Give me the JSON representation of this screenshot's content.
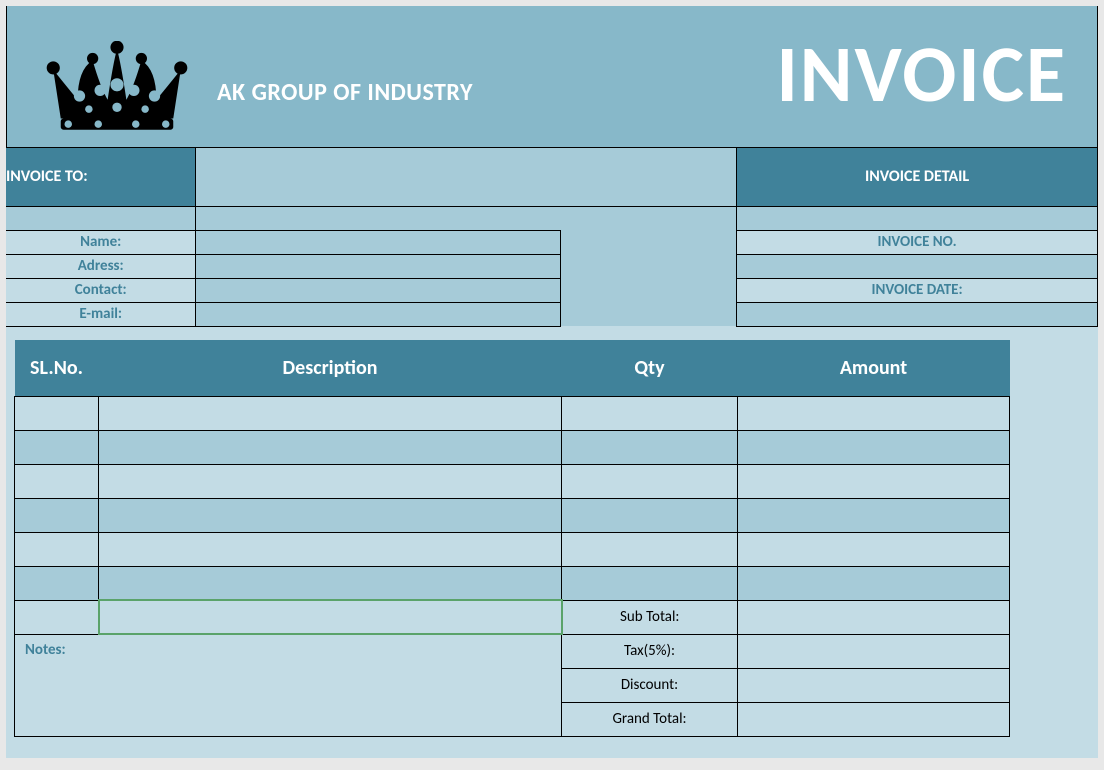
{
  "header": {
    "company": "AK GROUP OF INDUSTRY",
    "title": "INVOICE"
  },
  "invoice_to": {
    "heading": "INVOICE TO:",
    "fields": {
      "name_label": "Name:",
      "address_label": "Adress:",
      "contact_label": "Contact:",
      "email_label": "E-mail:",
      "name": "",
      "address": "",
      "contact": "",
      "email": ""
    }
  },
  "invoice_detail": {
    "heading": "INVOICE DETAIL",
    "no_label": "INVOICE NO.",
    "no_value": "",
    "date_label": "INVOICE DATE:",
    "date_value": ""
  },
  "columns": {
    "sl": "SL.No.",
    "desc": "Description",
    "qty": "Qty",
    "amount": "Amount"
  },
  "rows": [
    {
      "sl": "",
      "desc": "",
      "qty": "",
      "amount": ""
    },
    {
      "sl": "",
      "desc": "",
      "qty": "",
      "amount": ""
    },
    {
      "sl": "",
      "desc": "",
      "qty": "",
      "amount": ""
    },
    {
      "sl": "",
      "desc": "",
      "qty": "",
      "amount": ""
    },
    {
      "sl": "",
      "desc": "",
      "qty": "",
      "amount": ""
    },
    {
      "sl": "",
      "desc": "",
      "qty": "",
      "amount": ""
    }
  ],
  "totals": {
    "subtotal_label": "Sub Total:",
    "tax_label": "Tax(5%):",
    "discount_label": "Discount:",
    "grand_label": "Grand Total:",
    "subtotal": "",
    "tax": "",
    "discount": "",
    "grand": ""
  },
  "notes_label": "Notes:",
  "notes": ""
}
